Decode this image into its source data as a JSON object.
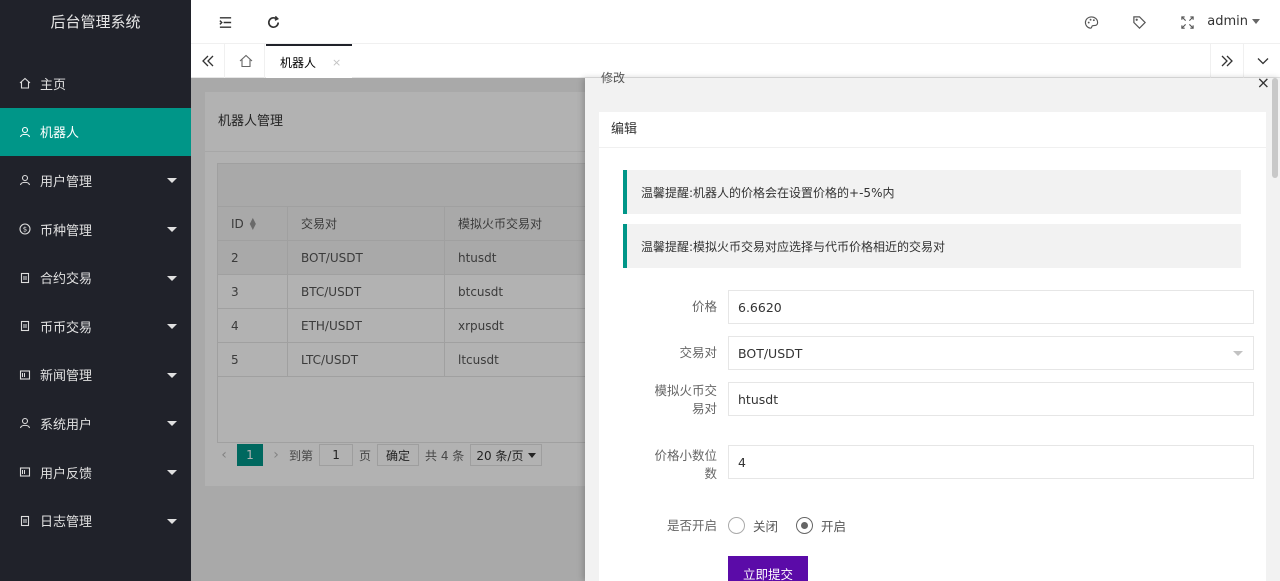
{
  "app": {
    "title": "后台管理系统"
  },
  "sidebar": {
    "items": [
      {
        "label": "主页",
        "icon": "home-icon",
        "active": false,
        "has_sub": false
      },
      {
        "label": "机器人",
        "icon": "user-icon",
        "active": true,
        "has_sub": false
      },
      {
        "label": "用户管理",
        "icon": "user-icon",
        "active": false,
        "has_sub": true
      },
      {
        "label": "币种管理",
        "icon": "dollar-icon",
        "active": false,
        "has_sub": true
      },
      {
        "label": "合约交易",
        "icon": "doc-icon",
        "active": false,
        "has_sub": true
      },
      {
        "label": "币币交易",
        "icon": "doc-icon",
        "active": false,
        "has_sub": true
      },
      {
        "label": "新闻管理",
        "icon": "news-icon",
        "active": false,
        "has_sub": true
      },
      {
        "label": "系统用户",
        "icon": "user-icon",
        "active": false,
        "has_sub": true
      },
      {
        "label": "用户反馈",
        "icon": "news-icon",
        "active": false,
        "has_sub": true
      },
      {
        "label": "日志管理",
        "icon": "doc-icon",
        "active": false,
        "has_sub": true
      }
    ]
  },
  "header": {
    "user": "admin"
  },
  "tabs": {
    "items": [
      {
        "label": "机器人",
        "close": "×"
      }
    ]
  },
  "list": {
    "title": "机器人管理",
    "columns": [
      "ID",
      "交易对",
      "模拟火币交易对"
    ],
    "rows": [
      [
        "2",
        "BOT/USDT",
        "htusdt"
      ],
      [
        "3",
        "BTC/USDT",
        "btcusdt"
      ],
      [
        "4",
        "ETH/USDT",
        "xrpusdt"
      ],
      [
        "5",
        "LTC/USDT",
        "ltcusdt"
      ]
    ],
    "pager": {
      "current": "1",
      "goto_label": "到第",
      "goto_value": "1",
      "page_unit": "页",
      "confirm": "确定",
      "total": "共 4 条",
      "per_page": "20 条/页"
    }
  },
  "drawer": {
    "title": "修改",
    "close": "×",
    "section": "编辑",
    "tips": [
      "温馨提醒:机器人的价格会在设置价格的+-5%内",
      "温馨提醒:模拟火币交易对应选择与代币价格相近的交易对"
    ],
    "fields": {
      "price": {
        "label": "价格",
        "value": "6.6620"
      },
      "pair": {
        "label": "交易对",
        "value": "BOT/USDT"
      },
      "sim_pair": {
        "label_1": "模拟火币交",
        "label_2": "易对",
        "value": "htusdt"
      },
      "decimals": {
        "label_1": "价格小数位",
        "label_2": "数",
        "value": "4"
      },
      "enabled": {
        "label": "是否开启",
        "off": "关闭",
        "on": "开启",
        "selected": "on"
      }
    },
    "submit": "立即提交"
  },
  "colors": {
    "sidebar": "#20222a",
    "accent": "#009688",
    "submit": "#5b0ba8"
  }
}
